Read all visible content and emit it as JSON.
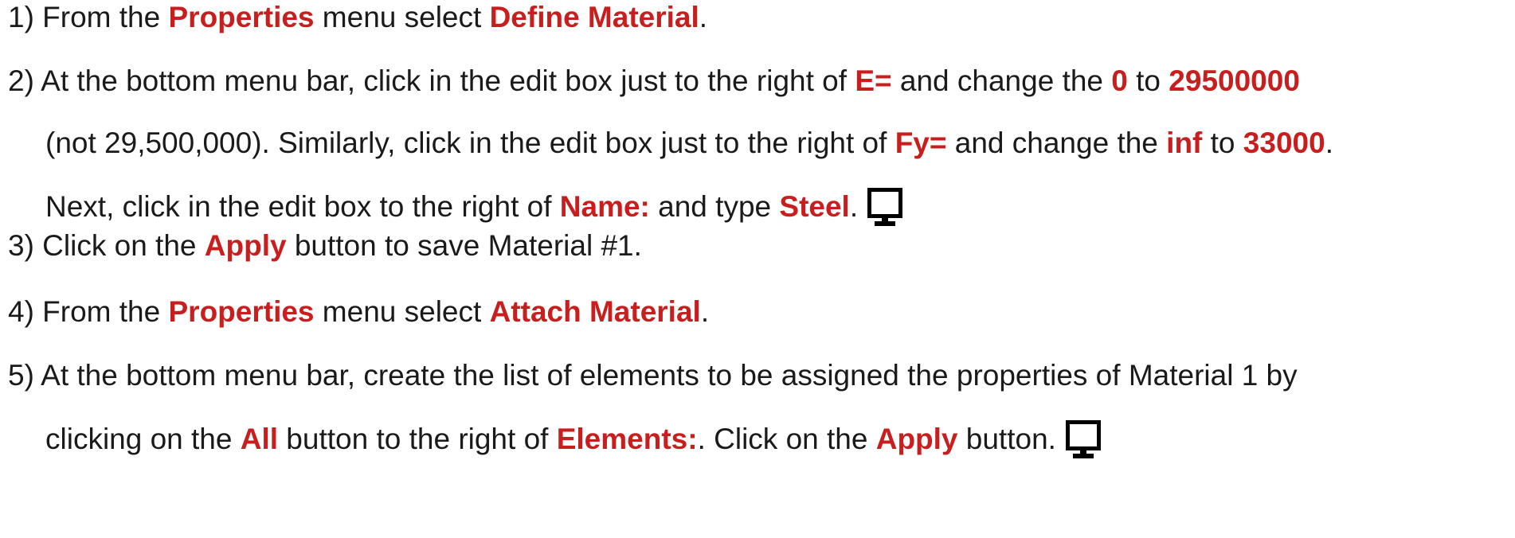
{
  "colors": {
    "highlight": "#c81e1e",
    "text": "#1a1a1a"
  },
  "steps": [
    {
      "lines": [
        [
          {
            "t": "1) From the ",
            "h": false
          },
          {
            "t": "Properties",
            "h": true
          },
          {
            "t": " menu select ",
            "h": false
          },
          {
            "t": "Define Material",
            "h": true
          },
          {
            "t": ".",
            "h": false
          }
        ]
      ]
    },
    {
      "lines": [
        [
          {
            "t": "2) At the bottom menu bar, click in the edit box just to the right of ",
            "h": false
          },
          {
            "t": "E=",
            "h": true
          },
          {
            "t": " and change the ",
            "h": false
          },
          {
            "t": "0",
            "h": true
          },
          {
            "t": " to ",
            "h": false
          },
          {
            "t": "29500000",
            "h": true
          }
        ],
        [
          {
            "t": "(not 29,500,000). Similarly, click in the edit box just to the right of ",
            "h": false
          },
          {
            "t": "Fy=",
            "h": true
          },
          {
            "t": " and change the ",
            "h": false
          },
          {
            "t": "inf",
            "h": true
          },
          {
            "t": " to ",
            "h": false
          },
          {
            "t": "33000",
            "h": true
          },
          {
            "t": ".",
            "h": false
          }
        ],
        [
          {
            "t": "Next, click in the edit box to the right of ",
            "h": false
          },
          {
            "t": "Name:",
            "h": true
          },
          {
            "t": " and type ",
            "h": false
          },
          {
            "t": "Steel",
            "h": true
          },
          {
            "t": ".",
            "h": false
          }
        ]
      ],
      "icon": "monitor-icon"
    },
    {
      "lines": [
        [
          {
            "t": "3) Click on the ",
            "h": false
          },
          {
            "t": "Apply",
            "h": true
          },
          {
            "t": " button to save Material #1.",
            "h": false
          }
        ]
      ]
    },
    {
      "lines": [
        [
          {
            "t": "4) From the ",
            "h": false
          },
          {
            "t": "Properties",
            "h": true
          },
          {
            "t": " menu select ",
            "h": false
          },
          {
            "t": "Attach Material",
            "h": true
          },
          {
            "t": ".",
            "h": false
          }
        ]
      ]
    },
    {
      "lines": [
        [
          {
            "t": "5) At the bottom menu bar, create the list of elements to be assigned the properties of Material 1 by",
            "h": false
          }
        ],
        [
          {
            "t": "clicking on the ",
            "h": false
          },
          {
            "t": "All",
            "h": true
          },
          {
            "t": " button to the right of ",
            "h": false
          },
          {
            "t": "Elements:",
            "h": true
          },
          {
            "t": ". Click on the ",
            "h": false
          },
          {
            "t": "Apply",
            "h": true
          },
          {
            "t": " button.",
            "h": false
          }
        ]
      ],
      "icon": "monitor-icon"
    }
  ]
}
